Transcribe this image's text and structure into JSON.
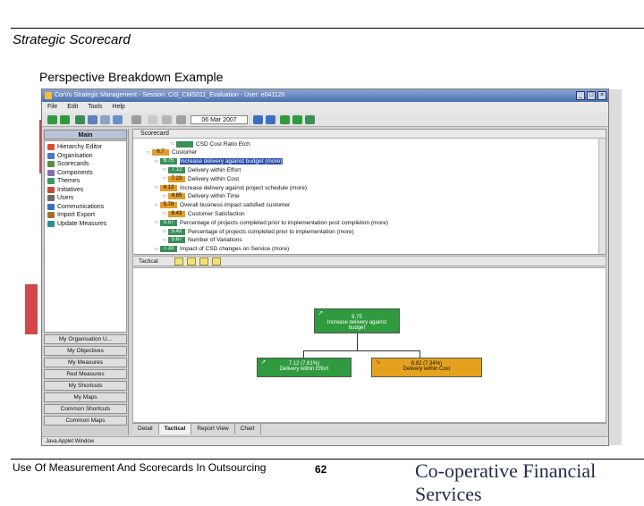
{
  "slide": {
    "title": "Strategic Scorecard",
    "subtitle": "Perspective Breakdown Example",
    "footer_text": "Use Of Measurement And Scorecards In Outsourcing",
    "page_number": "62",
    "brand": "Co-operative Financial Services"
  },
  "window": {
    "title": "CorVu Strategic Management - Session: CIS_CMS011_Evaluation - User: e041120",
    "menu": [
      "File",
      "Edit",
      "Tools",
      "Help"
    ],
    "date": "06 Mar 2007"
  },
  "sidebar": {
    "main_label": "Main",
    "items": [
      {
        "label": "Hierarchy Editor",
        "icon": "hierarchy-icon",
        "color": "#d9502a"
      },
      {
        "label": "Organisation",
        "icon": "organisation-icon",
        "color": "#4a78c8"
      },
      {
        "label": "Scorecards",
        "icon": "scorecard-icon",
        "color": "#5a8f3c"
      },
      {
        "label": "Components",
        "icon": "components-icon",
        "color": "#8a6bb0"
      },
      {
        "label": "Themes",
        "icon": "themes-icon",
        "color": "#3a9a5a"
      },
      {
        "label": "Initiatives",
        "icon": "initiatives-icon",
        "color": "#c44a3a"
      },
      {
        "label": "Users",
        "icon": "users-icon",
        "color": "#6b6b6b"
      },
      {
        "label": "Communications",
        "icon": "communications-icon",
        "color": "#3c6fb8"
      },
      {
        "label": "Import Export",
        "icon": "import-export-icon",
        "color": "#a0722e"
      },
      {
        "label": "Update Measures",
        "icon": "update-icon",
        "color": "#2f8f8f"
      }
    ],
    "buttons": [
      "My Organisation U...",
      "My Objectives",
      "My Measures",
      "Red Measures",
      "My Shortcuts",
      "My Maps",
      "Common Shortcuts",
      "Common Maps"
    ]
  },
  "tree": {
    "header": "Scorecard",
    "rows": [
      {
        "score": "",
        "text": "CSD Cost Ratio Etch",
        "color": "green",
        "indent": 4
      },
      {
        "score": "6.7",
        "text": "Customer",
        "color": "orange",
        "indent": 1
      },
      {
        "score": "6.75",
        "text": "Increase delivery against budget (more)",
        "color": "green",
        "indent": 2,
        "selected": true
      },
      {
        "score": "7.12",
        "text": "Delivery within Effort",
        "color": "green",
        "indent": 3
      },
      {
        "score": "7.23",
        "text": "Delivery within Cost",
        "color": "orange",
        "indent": 3
      },
      {
        "score": "4.13",
        "text": "Increase delivery against project schedule (more)",
        "color": "orange",
        "indent": 2
      },
      {
        "score": "4.85",
        "text": "Delivery within Time",
        "color": "orange",
        "indent": 3
      },
      {
        "score": "5.78",
        "text": "Overall business impact satisfied customer",
        "color": "orange",
        "indent": 2
      },
      {
        "score": "6.43",
        "text": "Customer Satisfaction",
        "color": "orange",
        "indent": 3
      },
      {
        "score": "5.57",
        "text": "Percentage of projects completed prior to implementation post completion (more)",
        "color": "green",
        "indent": 2
      },
      {
        "score": "5.42",
        "text": "Percentage of projects completed prior to implementation (more)",
        "color": "green",
        "indent": 3
      },
      {
        "score": "5.87",
        "text": "Number of Variations",
        "color": "green",
        "indent": 3
      },
      {
        "score": "7.33",
        "text": "Impact of CSD changes on Service (more)",
        "color": "green",
        "indent": 2
      }
    ]
  },
  "diagram": {
    "tab_label": "Tactical",
    "root": {
      "score": "6.75",
      "line1": "Increase delivery against",
      "line2": "budget"
    },
    "children": [
      {
        "score": "7.12 (7.61%)",
        "line1": "Delivery within Effort",
        "color": "green"
      },
      {
        "score": "6.82 (7.34%)",
        "line1": "Delivery within Cost",
        "color": "orange"
      }
    ]
  },
  "tabs": [
    "Detail",
    "Tactical",
    "Report View",
    "Chart"
  ],
  "active_tab": "Tactical",
  "status": "Java Applet Window"
}
